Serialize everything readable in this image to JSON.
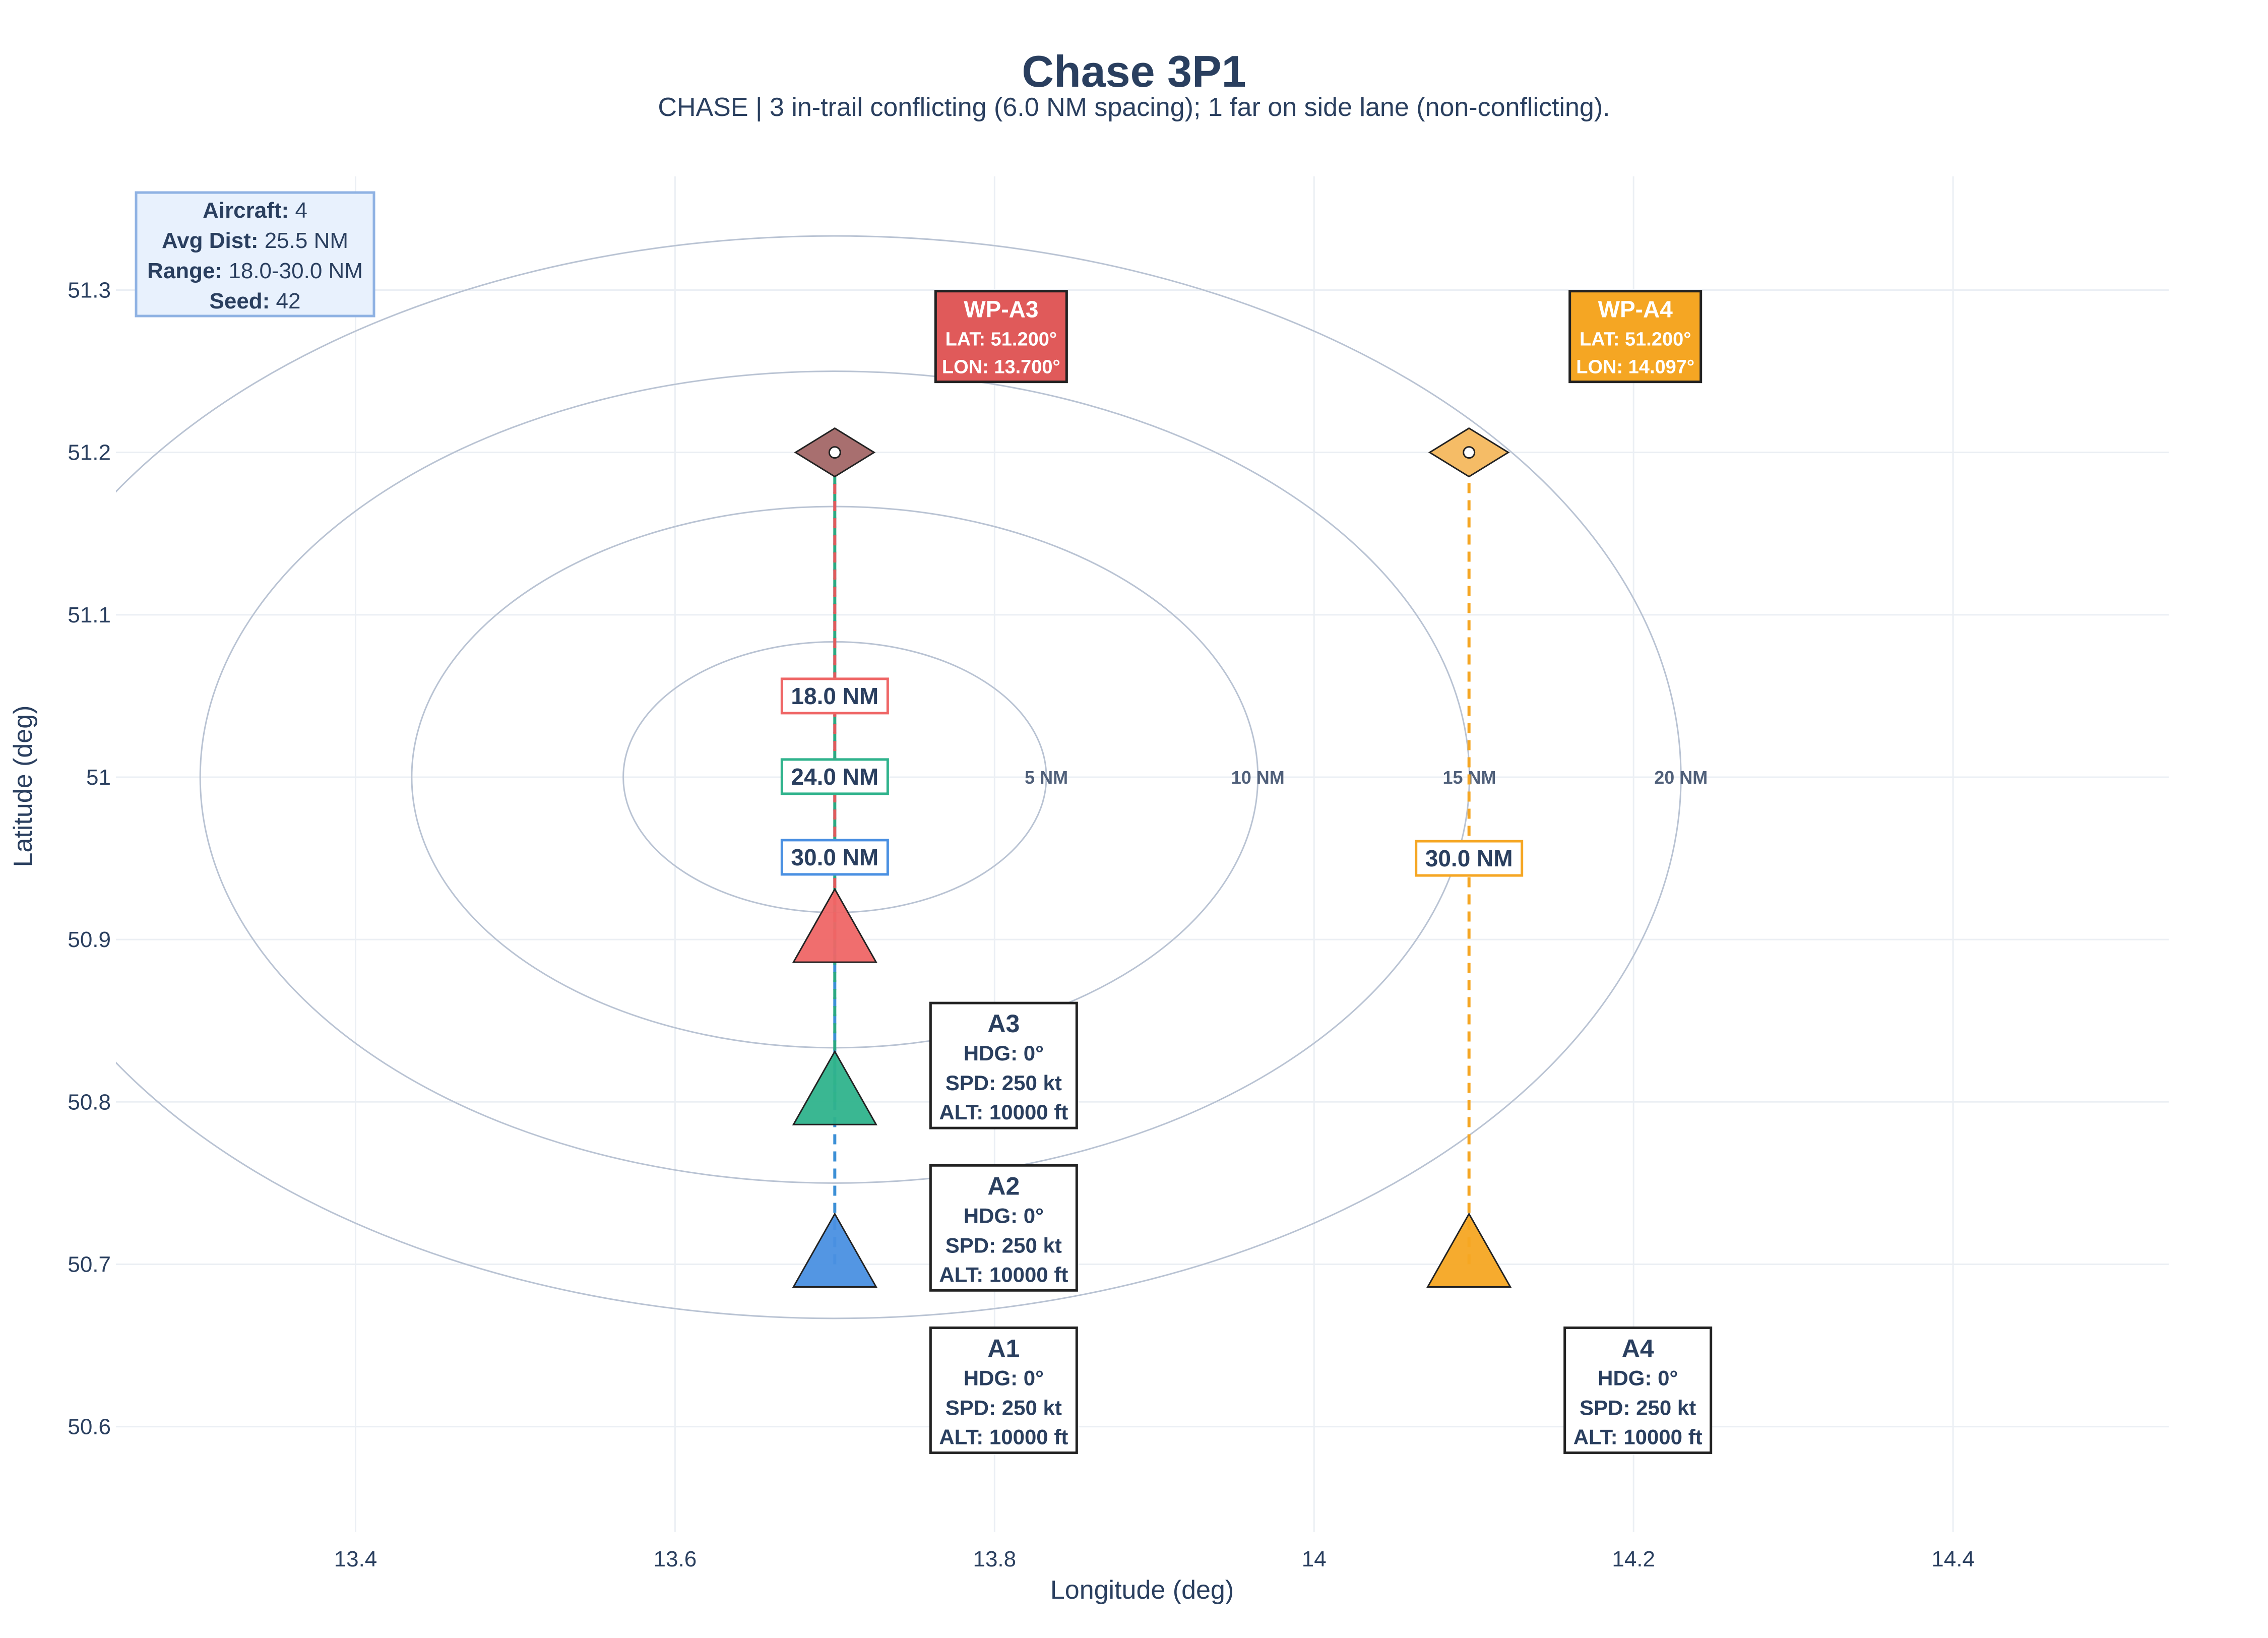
{
  "chart_data": {
    "type": "scatter",
    "title": "Chase 3P1",
    "subtitle": "CHASE | 3 in-trail conflicting (6.0 NM spacing); 1 far on side lane (non-conflicting).",
    "xlabel": "Longitude (deg)",
    "ylabel": "Latitude (deg)",
    "xlim": [
      13.25,
      14.535
    ],
    "ylim": [
      50.535,
      51.37
    ],
    "xticks": [
      13.4,
      13.6,
      13.8,
      14,
      14.2,
      14.4
    ],
    "xtick_labels": [
      "13.4",
      "13.6",
      "13.8",
      "14",
      "14.2",
      "14.4"
    ],
    "yticks": [
      50.6,
      50.7,
      50.8,
      50.9,
      51.0,
      51.1,
      51.2,
      51.3
    ],
    "ytick_labels": [
      "50.6",
      "50.7",
      "50.8",
      "50.9",
      "51",
      "51.1",
      "51.2",
      "51.3"
    ],
    "grid": true,
    "range_rings": {
      "center": [
        13.7,
        51.0
      ],
      "rings": [
        {
          "radius_nm": 5,
          "label": "5 NM"
        },
        {
          "radius_nm": 10,
          "label": "10 NM"
        },
        {
          "radius_nm": 15,
          "label": "15 NM"
        },
        {
          "radius_nm": 20,
          "label": "20 NM"
        }
      ]
    },
    "aircraft": [
      {
        "id": "A1",
        "lon": 13.7,
        "lat": 50.7,
        "color": "#4a90e2",
        "hdg": "HDG: 0°",
        "spd": "SPD: 250 kt",
        "alt": "ALT: 10000 ft",
        "distance": "30.0 NM",
        "waypoint": "A3"
      },
      {
        "id": "A2",
        "lon": 13.7,
        "lat": 50.8,
        "color": "#2fb38c",
        "hdg": "HDG: 0°",
        "spd": "SPD: 250 kt",
        "alt": "ALT: 10000 ft",
        "distance": "24.0 NM",
        "waypoint": "A3"
      },
      {
        "id": "A3",
        "lon": 13.7,
        "lat": 50.9,
        "color": "#ef6666",
        "hdg": "HDG: 0°",
        "spd": "SPD: 250 kt",
        "alt": "ALT: 10000 ft",
        "distance": "18.0 NM",
        "waypoint": "A3"
      },
      {
        "id": "A4",
        "lon": 14.097,
        "lat": 50.7,
        "color": "#f5a623",
        "hdg": "HDG: 0°",
        "spd": "SPD: 250 kt",
        "alt": "ALT: 10000 ft",
        "distance": "30.0 NM",
        "waypoint": "A4"
      }
    ],
    "waypoints": [
      {
        "id": "A3",
        "name": "WP-A3",
        "lon": 13.7,
        "lat": 51.2,
        "marker_color": "#a86f6f",
        "box_color": "#e05a5a",
        "route_color": "#e05a5a",
        "lat_label": "LAT: 51.200°",
        "lon_label": "LON: 13.700°"
      },
      {
        "id": "A4",
        "name": "WP-A4",
        "lon": 14.097,
        "lat": 51.2,
        "marker_color": "#f5bc66",
        "box_color": "#f5a623",
        "route_color": "#f5a623",
        "lat_label": "LAT: 51.200°",
        "lon_label": "LON: 14.097°"
      }
    ],
    "info_box": [
      {
        "key": "Aircraft:",
        "value": "4"
      },
      {
        "key": "Avg Dist:",
        "value": "25.5 NM"
      },
      {
        "key": "Range:",
        "value": "18.0-30.0 NM"
      },
      {
        "key": "Seed:",
        "value": "42"
      }
    ]
  }
}
